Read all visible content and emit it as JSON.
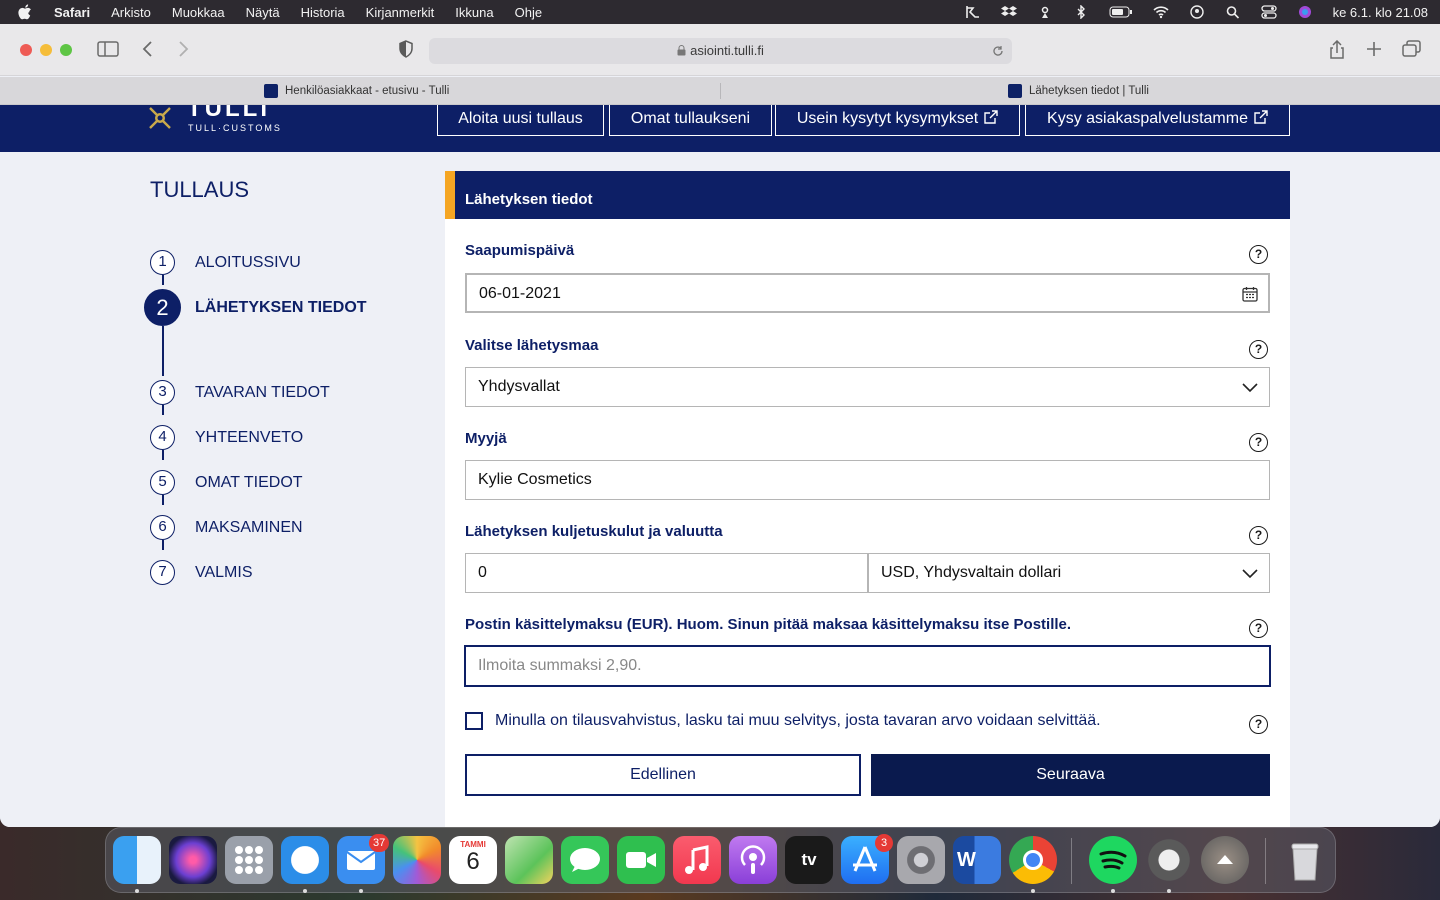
{
  "menubar": {
    "app": "Safari",
    "items": [
      "Arkisto",
      "Muokkaa",
      "Näytä",
      "Historia",
      "Kirjanmerkit",
      "Ikkuna",
      "Ohje"
    ],
    "clock": "ke 6.1. klo  21.08",
    "status_icons": [
      "remote-icon",
      "dropbox-icon",
      "airplay-icon",
      "bluetooth-icon",
      "battery-icon",
      "wifi-icon",
      "user-icon",
      "spotlight-icon",
      "control-center-icon",
      "siri-icon"
    ]
  },
  "browser": {
    "url": "asiointi.tulli.fi",
    "tabs": [
      {
        "title": "Henkilöasiakkaat - etusivu - Tulli"
      },
      {
        "title": "Lähetyksen tiedot | Tulli"
      }
    ]
  },
  "site": {
    "logo_name": "TULLI",
    "logo_sub": "TULL·CUSTOMS",
    "nav": [
      {
        "label": "Aloita uusi tullaus",
        "external": false
      },
      {
        "label": "Omat tullaukseni",
        "external": false
      },
      {
        "label": "Usein kysytyt kysymykset",
        "external": true
      },
      {
        "label": "Kysy asiakaspalvelustamme",
        "external": true
      }
    ],
    "accent": "#0d1f66",
    "highlight": "#f5a623"
  },
  "sidebar": {
    "title": "TULLAUS",
    "steps": [
      {
        "n": "1",
        "label": "ALOITUSSIVU"
      },
      {
        "n": "2",
        "label": "LÄHETYKSEN TIEDOT",
        "active": true
      },
      {
        "n": "3",
        "label": "TAVARAN TIEDOT"
      },
      {
        "n": "4",
        "label": "YHTEENVETO"
      },
      {
        "n": "5",
        "label": "OMAT TIEDOT"
      },
      {
        "n": "6",
        "label": "MAKSAMINEN"
      },
      {
        "n": "7",
        "label": "VALMIS"
      }
    ]
  },
  "form": {
    "title": "Lähetyksen tiedot",
    "arrival_label": "Saapumispäivä",
    "arrival_value": "06-01-2021",
    "country_label": "Valitse lähetysmaa",
    "country_value": "Yhdysvallat",
    "seller_label": "Myyjä",
    "seller_value": "Kylie Cosmetics",
    "shipping_label": "Lähetyksen kuljetuskulut ja valuutta",
    "shipping_value": "0",
    "currency_value": "USD, Yhdysvaltain dollari",
    "fee_label": "Postin käsittelymaksu (EUR). Huom. Sinun pitää maksaa käsittelymaksu itse Postille.",
    "fee_placeholder": "Ilmoita summaksi 2,90.",
    "checkbox_label": "Minulla on tilausvahvistus, lasku tai muu selvitys, josta tavaran arvo voidaan selvittää.",
    "checkbox_checked": false,
    "help_glyph": "?",
    "prev_label": "Edellinen",
    "next_label": "Seuraava"
  },
  "dock": {
    "apps": [
      {
        "name": "finder-icon",
        "color": "#3aa0f0"
      },
      {
        "name": "siri-icon",
        "color": "#6b3fd1"
      },
      {
        "name": "launchpad-icon",
        "color": "#9aa0aa"
      },
      {
        "name": "safari-icon",
        "color": "#2b8de8"
      },
      {
        "name": "mail-icon",
        "color": "#3a8ef0",
        "badge": "37"
      },
      {
        "name": "photos-icon",
        "color": "#f0f0f0"
      },
      {
        "name": "calendar-icon",
        "color": "#ffffff",
        "month": "TAMMI",
        "day": "6"
      },
      {
        "name": "maps-icon",
        "color": "#5cc35a"
      },
      {
        "name": "messages-icon",
        "color": "#35c759"
      },
      {
        "name": "facetime-icon",
        "color": "#2fbf4f"
      },
      {
        "name": "music-icon",
        "color": "#f2384f"
      },
      {
        "name": "podcasts-icon",
        "color": "#9b4ae0"
      },
      {
        "name": "appletv-icon",
        "color": "#1a1a1a",
        "text": "tv"
      },
      {
        "name": "appstore-icon",
        "color": "#1f8ef1",
        "badge": "3"
      },
      {
        "name": "system-preferences-icon",
        "color": "#8e8e93"
      },
      {
        "name": "word-icon",
        "color": "#2b5cb8",
        "text": "W"
      },
      {
        "name": "chrome-icon",
        "color": "#e8e8e8"
      },
      {
        "name": "spotify-icon",
        "color": "#1ed760"
      },
      {
        "name": "istat-icon",
        "color": "#5a5a5a"
      },
      {
        "name": "download-icon",
        "color": "#6a6a6a"
      },
      {
        "name": "trash-icon",
        "color": "#c8c8cc"
      }
    ]
  }
}
